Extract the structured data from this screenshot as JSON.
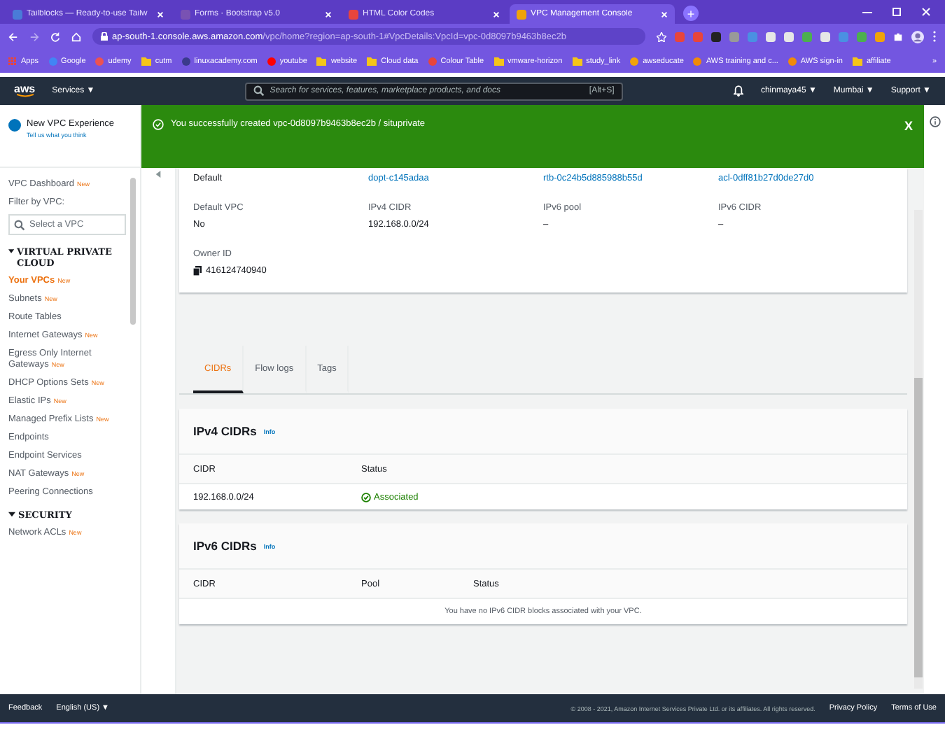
{
  "browser": {
    "tabs": [
      {
        "title": "Tailblocks — Ready-to-use Tailw",
        "selected": false,
        "color": "#4a7bd8"
      },
      {
        "title": "Forms · Bootstrap v5.0",
        "selected": false,
        "color": "#7952b3"
      },
      {
        "title": "HTML Color Codes",
        "selected": false,
        "color": "#e8453c"
      },
      {
        "title": "VPC Management Console",
        "selected": true,
        "color": "#f0a30a"
      }
    ],
    "new_tab": "+",
    "address": {
      "host": "ap-south-1.console.aws.amazon.com",
      "path": "/vpc/home?region=ap-south-1#VpcDetails:VpcId=vpc-0d8097b9463b8ec2b"
    },
    "bookmarks": [
      {
        "label": "Apps",
        "kind": "grid",
        "color": "#e8453c"
      },
      {
        "label": "Google",
        "kind": "site",
        "color": "#4285f4"
      },
      {
        "label": "udemy",
        "kind": "site",
        "color": "#ec5252"
      },
      {
        "label": "cutm",
        "kind": "folder",
        "color": "#f5c518"
      },
      {
        "label": "linuxacademy.com",
        "kind": "site",
        "color": "#3a3a8c"
      },
      {
        "label": "youtube",
        "kind": "site",
        "color": "#ff0000"
      },
      {
        "label": "website",
        "kind": "folder",
        "color": "#f5c518"
      },
      {
        "label": "Cloud data",
        "kind": "folder",
        "color": "#f5c518"
      },
      {
        "label": "Colour Table",
        "kind": "site",
        "color": "#e8453c"
      },
      {
        "label": "vmware-horizon",
        "kind": "folder",
        "color": "#f5c518"
      },
      {
        "label": "study_link",
        "kind": "folder",
        "color": "#f5c518"
      },
      {
        "label": "awseducate",
        "kind": "site",
        "color": "#f0a30a"
      },
      {
        "label": "AWS training and c...",
        "kind": "site",
        "color": "#f08a0a"
      },
      {
        "label": "AWS sign-in",
        "kind": "site",
        "color": "#f08a0a"
      },
      {
        "label": "affiliate",
        "kind": "folder",
        "color": "#f5c518"
      }
    ],
    "more": "»"
  },
  "aws_nav": {
    "logo": "aws",
    "services": "Services ▼",
    "search": {
      "placeholder": "Search for services, features, marketplace products, and docs",
      "shortcut": "[Alt+S]"
    },
    "user": "chinmaya45 ▼",
    "region": "Mumbai ▼",
    "support": "Support ▼"
  },
  "sidebar": {
    "promo": {
      "title": "New VPC Experience",
      "subtitle": "Tell us what you think",
      "on": true
    },
    "dashboard": {
      "label": "VPC Dashboard",
      "badge": "New"
    },
    "filter_label": "Filter by VPC:",
    "filter": {
      "placeholder": "Select a VPC"
    },
    "sections": [
      {
        "title": "VIRTUAL PRIVATE CLOUD",
        "expanded": true,
        "items": [
          {
            "label": "Your VPCs",
            "badge": "New",
            "selected": true
          },
          {
            "label": "Subnets",
            "badge": "New",
            "selected": false
          },
          {
            "label": "Route Tables",
            "selected": false
          },
          {
            "label": "Internet Gateways",
            "badge": "New",
            "selected": false
          },
          {
            "label": "Egress Only Internet Gateways",
            "badge": "New",
            "selected": false
          },
          {
            "label": "DHCP Options Sets",
            "badge": "New",
            "selected": false
          },
          {
            "label": "Elastic IPs",
            "badge": "New",
            "selected": false
          },
          {
            "label": "Managed Prefix Lists",
            "badge": "New",
            "selected": false
          },
          {
            "label": "Endpoints",
            "selected": false
          },
          {
            "label": "Endpoint Services",
            "selected": false
          },
          {
            "label": "NAT Gateways",
            "badge": "New",
            "selected": false
          },
          {
            "label": "Peering Connections",
            "selected": false
          }
        ]
      },
      {
        "title": "SECURITY",
        "expanded": true,
        "items": [
          {
            "label": "Network ACLs",
            "badge": "New",
            "selected": false
          }
        ]
      }
    ]
  },
  "banner": {
    "message": "You successfully created vpc-0d8097b9463b8ec2b / situprivate",
    "close": "X"
  },
  "details": {
    "rows": [
      [
        {
          "value": "Default",
          "kind": "text"
        },
        {
          "value": "dopt-c145adaa",
          "kind": "link"
        },
        {
          "value": "rtb-0c24b5d885988b55d",
          "kind": "link"
        },
        {
          "value": "acl-0dff81b27d0de27d0",
          "kind": "link"
        }
      ],
      [
        {
          "label": "Default VPC",
          "value": "No",
          "kind": "text"
        },
        {
          "label": "IPv4 CIDR",
          "value": "192.168.0.0/24",
          "kind": "text"
        },
        {
          "label": "IPv6 pool",
          "value": "–",
          "kind": "text"
        },
        {
          "label": "IPv6 CIDR",
          "value": "–",
          "kind": "text"
        }
      ],
      [
        {
          "label": "Owner ID",
          "value": "416124740940",
          "kind": "copy"
        }
      ]
    ]
  },
  "tabs": [
    {
      "label": "CIDRs",
      "selected": true
    },
    {
      "label": "Flow logs",
      "selected": false
    },
    {
      "label": "Tags",
      "selected": false
    }
  ],
  "ipv4": {
    "title": "IPv4 CIDRs",
    "info": "Info",
    "columns": [
      "CIDR",
      "Status"
    ],
    "rows": [
      {
        "cidr": "192.168.0.0/24",
        "status": "Associated"
      }
    ]
  },
  "ipv6": {
    "title": "IPv6 CIDRs",
    "info": "Info",
    "columns": [
      "CIDR",
      "Pool",
      "Status"
    ],
    "empty": "You have no IPv6 CIDR blocks associated with your VPC."
  },
  "footer": {
    "feedback": "Feedback",
    "language": "English (US) ▼",
    "copyright": "© 2008 - 2021, Amazon Internet Services Private Ltd. or its affiliates. All rights reserved.",
    "links": [
      "Privacy Policy",
      "Terms of Use"
    ]
  }
}
